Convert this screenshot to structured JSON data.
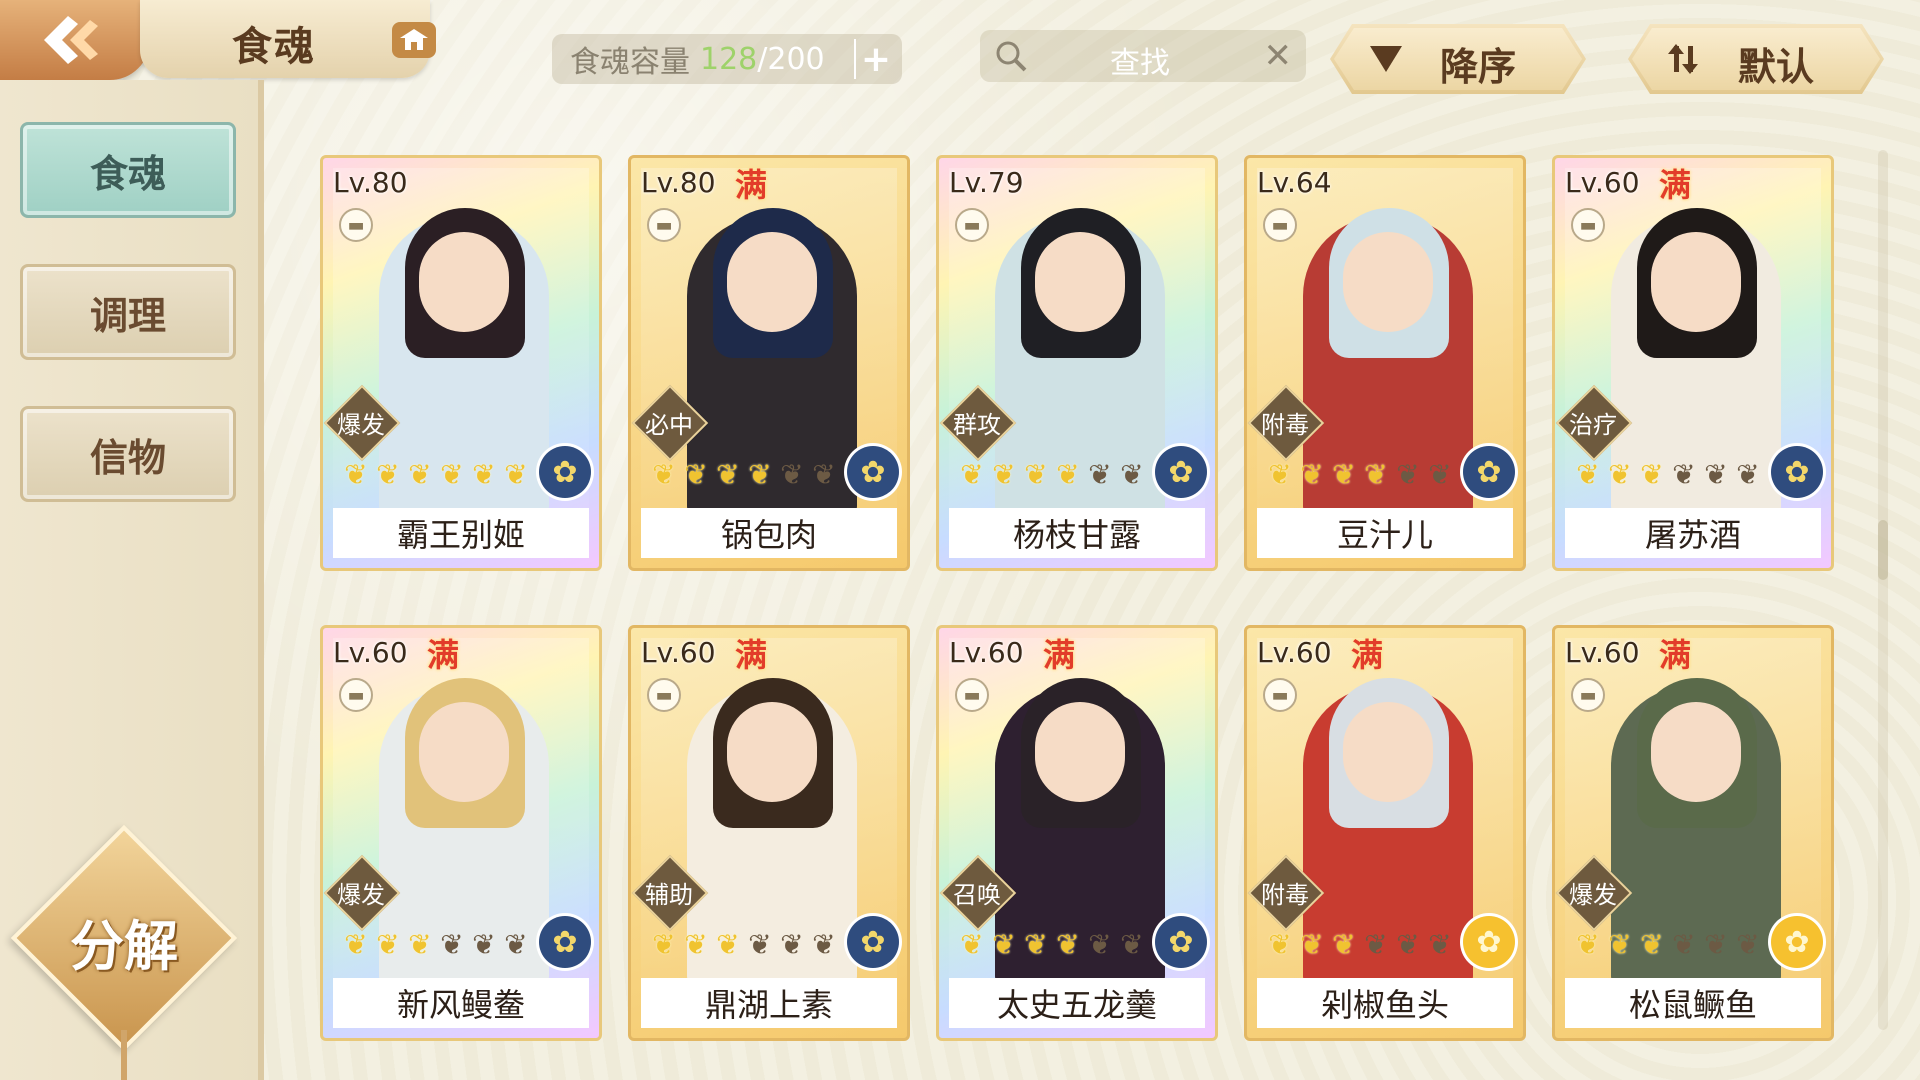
{
  "header": {
    "title": "食魂",
    "capacity_label": "食魂容量",
    "capacity_current": "128",
    "capacity_separator": "/",
    "capacity_max": "200",
    "search_placeholder": "查找",
    "sort_order_label": "降序",
    "sort_mode_label": "默认"
  },
  "sidebar": {
    "items": [
      {
        "label": "食魂",
        "active": true
      },
      {
        "label": "调理",
        "active": false
      },
      {
        "label": "信物",
        "active": false
      }
    ],
    "decompose_label": "分解"
  },
  "cards": [
    {
      "level": "Lv.80",
      "full": "",
      "type": "爆发",
      "stars": 6,
      "element": "blue",
      "name": "霸王别姬",
      "frame": "rainbow",
      "hair": "#2b1f24",
      "cloth": "#d8e6ef"
    },
    {
      "level": "Lv.80",
      "full": "满",
      "type": "必中",
      "stars": 4,
      "element": "blue",
      "name": "锅包肉",
      "frame": "gold",
      "hair": "#1e2a4a",
      "cloth": "#2f2a2e"
    },
    {
      "level": "Lv.79",
      "full": "",
      "type": "群攻",
      "stars": 4,
      "element": "blue",
      "name": "杨枝甘露",
      "frame": "rainbow",
      "hair": "#1f1f24",
      "cloth": "#cfe1e4"
    },
    {
      "level": "Lv.64",
      "full": "",
      "type": "附毒",
      "stars": 4,
      "element": "blue",
      "name": "豆汁儿",
      "frame": "gold",
      "hair": "#cfe0e6",
      "cloth": "#b83c34"
    },
    {
      "level": "Lv.60",
      "full": "满",
      "type": "治疗",
      "stars": 3,
      "element": "blue",
      "name": "屠苏酒",
      "frame": "rainbow",
      "hair": "#1f1a18",
      "cloth": "#f1ebe0"
    },
    {
      "level": "Lv.60",
      "full": "满",
      "type": "爆发",
      "stars": 3,
      "element": "blue",
      "name": "新风鳗鲞",
      "frame": "rainbow",
      "hair": "#e1c27a",
      "cloth": "#e8ecec"
    },
    {
      "level": "Lv.60",
      "full": "满",
      "type": "辅助",
      "stars": 3,
      "element": "blue",
      "name": "鼎湖上素",
      "frame": "gold",
      "hair": "#3a2a1e",
      "cloth": "#f4ede0"
    },
    {
      "level": "Lv.60",
      "full": "满",
      "type": "召唤",
      "stars": 4,
      "element": "blue",
      "name": "太史五龙羹",
      "frame": "rainbow",
      "hair": "#2a2228",
      "cloth": "#2e2030"
    },
    {
      "level": "Lv.60",
      "full": "满",
      "type": "附毒",
      "stars": 3,
      "element": "gold",
      "name": "剁椒鱼头",
      "frame": "gold",
      "hair": "#d8dee3",
      "cloth": "#c83c30"
    },
    {
      "level": "Lv.60",
      "full": "满",
      "type": "爆发",
      "stars": 3,
      "element": "gold",
      "name": "松鼠鳜鱼",
      "frame": "gold",
      "hair": "#5a6a4a",
      "cloth": "#5d6a52"
    }
  ]
}
